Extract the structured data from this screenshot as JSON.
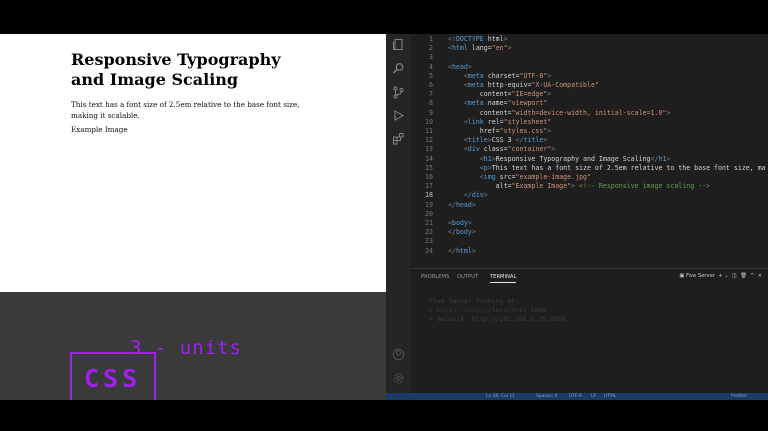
{
  "preview": {
    "heading": "Responsive Typography and Image Scaling",
    "paragraph": "This text has a font size of 2.5em relative to the base font size, making it scalable.",
    "image_alt": "Example Image"
  },
  "branding": {
    "units_label": "3 - units",
    "css_label": "CSS",
    "accent_color": "#a020f0"
  },
  "editor": {
    "current_line": "18",
    "lines": [
      {
        "n": "1",
        "text": "<!DOCTYPE html>"
      },
      {
        "n": "2",
        "text": "<html lang=\"en\">"
      },
      {
        "n": "3",
        "text": ""
      },
      {
        "n": "4",
        "text": "<head>"
      },
      {
        "n": "5",
        "text": "    <meta charset=\"UTF-8\">"
      },
      {
        "n": "6",
        "text": "    <meta http-equiv=\"X-UA-Compatible\""
      },
      {
        "n": "7",
        "text": "        content=\"IE=edge\">"
      },
      {
        "n": "8",
        "text": "    <meta name=\"viewport\""
      },
      {
        "n": "9",
        "text": "        content=\"width=device-width, initial-scale=1.0\">"
      },
      {
        "n": "10",
        "text": "    <link rel=\"stylesheet\""
      },
      {
        "n": "11",
        "text": "        href=\"styles.css\">"
      },
      {
        "n": "12",
        "text": "    <title>CSS 3 </title>"
      },
      {
        "n": "13",
        "text": "    <div class=\"container\">"
      },
      {
        "n": "14",
        "text": "        <h1>Responsive Typography and Image Scaling</h1>"
      },
      {
        "n": "15",
        "text": "        <p>This text has a font size of 2.5em relative to the base font size, ma"
      },
      {
        "n": "16",
        "text": "        <img src=\"example-image.jpg\""
      },
      {
        "n": "17",
        "text": "            alt=\"Example Image\"> <!-- Responsive image scaling -->"
      },
      {
        "n": "18",
        "text": "    </div>"
      },
      {
        "n": "19",
        "text": "</head>"
      },
      {
        "n": "20",
        "text": ""
      },
      {
        "n": "21",
        "text": "<body>"
      },
      {
        "n": "22",
        "text": "</body>"
      },
      {
        "n": "23",
        "text": ""
      },
      {
        "n": "24",
        "text": "</html>"
      }
    ]
  },
  "panel": {
    "tabs": [
      "PROBLEMS",
      "OUTPUT",
      "TERMINAL"
    ],
    "active_tab": "TERMINAL",
    "terminal_name": "Five Server",
    "terminal_lines": [
      "Five Server running at:",
      "> Local:   http://localhost:8080",
      "> Network: http://192.168.1.75:8080"
    ]
  },
  "status_bar": {
    "position": "Ln 18, Col 11",
    "spaces": "Spaces: 4",
    "encoding": "UTF-8",
    "eol": "LF",
    "language": "HTML",
    "prettier": "Prettier"
  },
  "icons": [
    "files-icon",
    "search-icon",
    "source-control-icon",
    "run-debug-icon",
    "extensions-icon",
    "account-icon",
    "settings-icon"
  ]
}
